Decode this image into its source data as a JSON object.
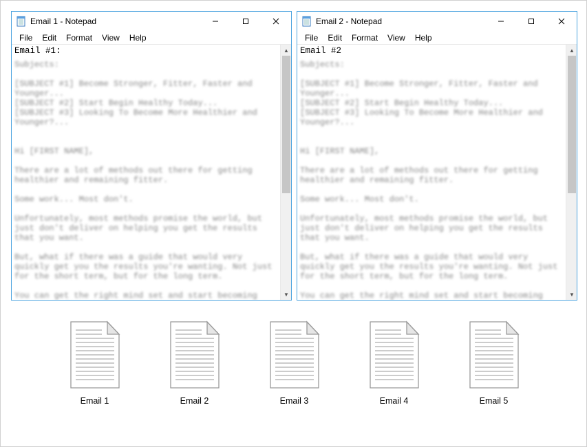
{
  "windows": [
    {
      "title": "Email 1 - Notepad",
      "firstline": "Email #1:",
      "body": "Subjects:\n\n[SUBJECT #1] Become Stronger, Fitter, Faster and Younger...\n[SUBJECT #2] Start Begin Healthy Today...\n[SUBJECT #3] Looking To Become More Healthier and Younger?...\n\n\nHi [FIRST NAME],\n\nThere are a lot of methods out there for getting healthier and remaining fitter.\n\nSome work... Most don't.\n\nUnfortunately, most methods promise the world, but just don't deliver on helping you get the results that you want.\n\nBut, what if there was a guide that would very quickly get you the results you're wanting. Not just for the short term, but for the long term.\n\nYou can get the right mind set and start becoming stronger, fitter, faster and younger today.\n\nThe best part? You're actually helping your loved ones as you'll be fitter and healthier to spend quality time with them.\n\nTo discover what how this can be achieved today by clicking the"
    },
    {
      "title": "Email 2 - Notepad",
      "firstline": "Email #2",
      "body": "Subjects:\n\n[SUBJECT #1] Become Stronger, Fitter, Faster and Younger...\n[SUBJECT #2] Start Begin Healthy Today...\n[SUBJECT #3] Looking To Become More Healthier and Younger?...\n\n\nHi [FIRST NAME],\n\nThere are a lot of methods out there for getting healthier and remaining fitter.\n\nSome work... Most don't.\n\nUnfortunately, most methods promise the world, but just don't deliver on helping you get the results that you want.\n\nBut, what if there was a guide that would very quickly get you the results you're wanting. Not just for the short term, but for the long term.\n\nYou can get the right mind set and start becoming stronger, fitter, faster and younger today.\n\nThe best part? You're actually helping your loved ones as you'll be fitter and healthier to spend quality time with them.\n\nTo discover what how this can be achieved today by clicking the"
    }
  ],
  "menu": {
    "file": "File",
    "edit": "Edit",
    "format": "Format",
    "view": "View",
    "help": "Help"
  },
  "files": [
    {
      "label": "Email 1"
    },
    {
      "label": "Email 2"
    },
    {
      "label": "Email 3"
    },
    {
      "label": "Email 4"
    },
    {
      "label": "Email 5"
    }
  ]
}
